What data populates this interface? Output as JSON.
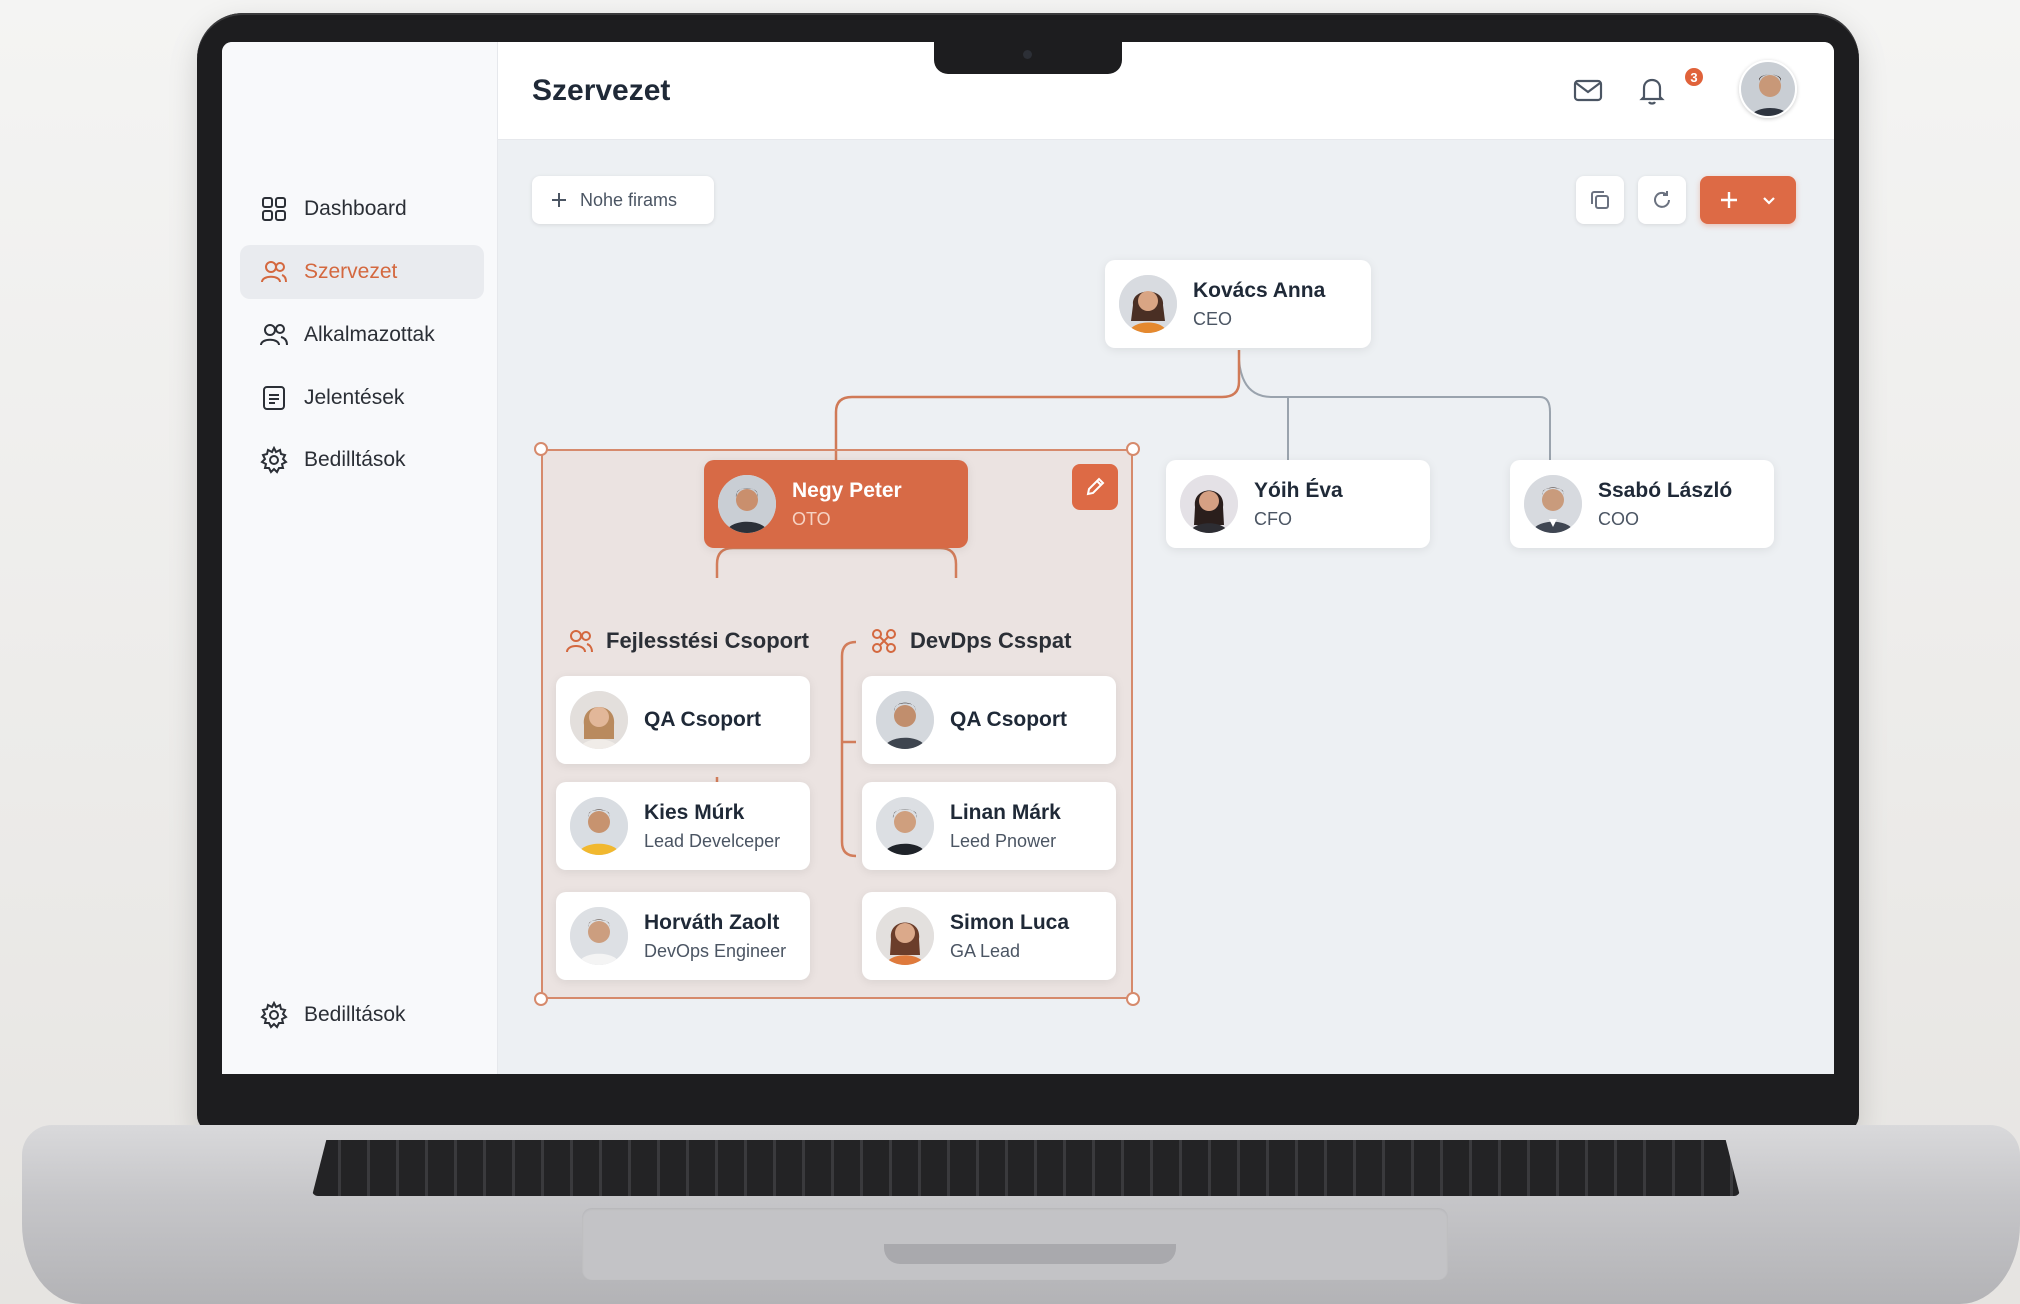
{
  "app": {
    "page_title": "Szervezet"
  },
  "sidebar": {
    "items": [
      {
        "label": "Dashboard",
        "icon": "grid-icon",
        "active": false
      },
      {
        "label": "Szervezet",
        "icon": "users-icon",
        "active": true
      },
      {
        "label": "Alkalmazottak",
        "icon": "people-icon",
        "active": false
      },
      {
        "label": "Jelentések",
        "icon": "document-icon",
        "active": false
      },
      {
        "label": "Bedilltások",
        "icon": "gear-icon",
        "active": false
      }
    ],
    "footer_item": {
      "label": "Bedilltások",
      "icon": "gear-icon"
    }
  },
  "topbar": {
    "notification_count": "3",
    "icons": [
      "mail-icon",
      "bell-icon"
    ]
  },
  "toolbar": {
    "add_company_label": "Nohe firams",
    "tools": [
      "copy-icon",
      "refresh-icon"
    ],
    "primary_action_icons": [
      "plus-icon",
      "chevron-down-icon"
    ]
  },
  "org": {
    "root": {
      "name": "Kovács Anna",
      "role": "CEO"
    },
    "level1": [
      {
        "name": "Negy Peter",
        "role": "OTO",
        "selected": true
      },
      {
        "name": "Yóih Éva",
        "role": "CFO"
      },
      {
        "name": "Ssabó László",
        "role": "COO"
      }
    ],
    "groups": [
      {
        "label": "Fejlesstési Csoport",
        "icon": "team-icon",
        "members": [
          {
            "name": "QA Csoport",
            "role": ""
          },
          {
            "name": "Kies Múrk",
            "role": "Lead Develceper"
          },
          {
            "name": "Horváth Zaolt",
            "role": "DevOps Engineer"
          }
        ]
      },
      {
        "label": "DevDps Csspat",
        "icon": "network-icon",
        "members": [
          {
            "name": "QA Csoport",
            "role": ""
          },
          {
            "name": "Linan Márk",
            "role": "Leed Pnower"
          },
          {
            "name": "Simon Luca",
            "role": "GA Lead"
          }
        ]
      }
    ]
  },
  "colors": {
    "accent": "#dd6a45",
    "accent_soft": "#d68a6c",
    "connector_gray": "#9aa3ad",
    "screen_bg": "#edf0f3"
  }
}
